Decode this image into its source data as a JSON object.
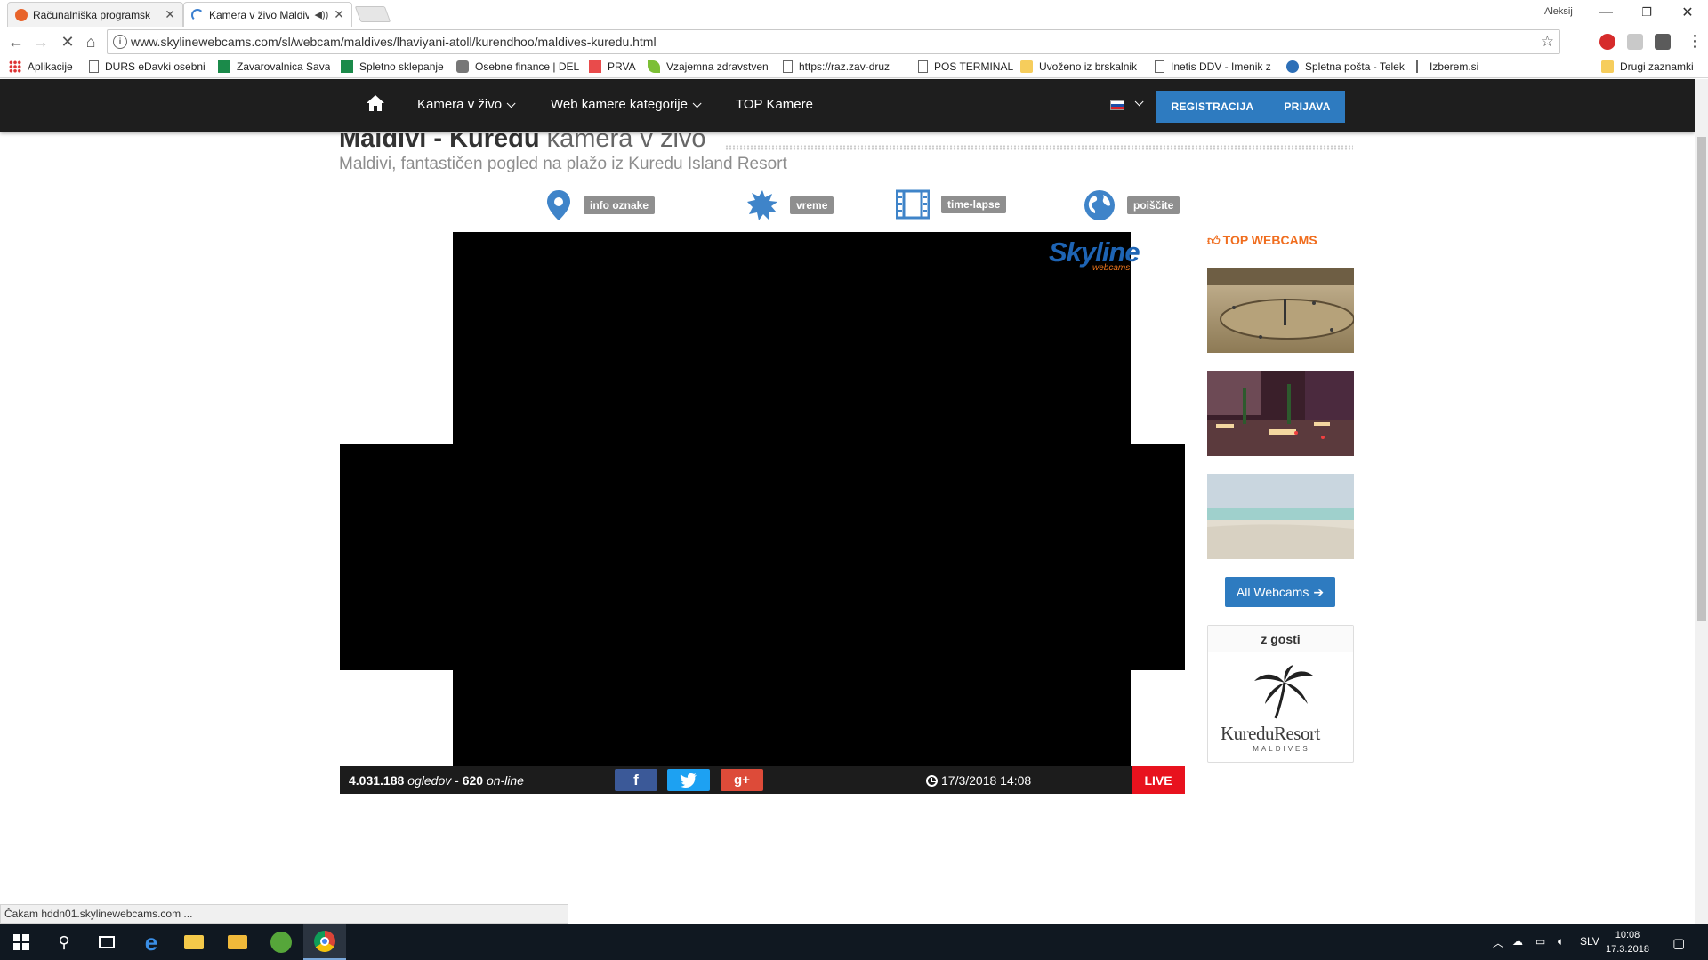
{
  "browser": {
    "tabs": [
      {
        "title": "Računalniška programsk",
        "active": false
      },
      {
        "title": "Kamera v živo Maldiv",
        "active": true
      }
    ],
    "profile_name": "Aleksij",
    "url": "www.skylinewebcams.com/sl/webcam/maldives/lhaviyani-atoll/kurendhoo/maldives-kuredu.html",
    "bookmarks": [
      {
        "label": "Aplikacije",
        "icon": "apps-grid-icon"
      },
      {
        "label": "DURS eDavki osebni",
        "icon": "page-icon"
      },
      {
        "label": "Zavarovalnica Sava",
        "icon": "sava-icon"
      },
      {
        "label": "Spletno sklepanje",
        "icon": "sava-icon"
      },
      {
        "label": "Osebne finance | DEL",
        "icon": "finance-icon"
      },
      {
        "label": "PRVA",
        "icon": "prva-icon"
      },
      {
        "label": "Vzajemna zdravstven",
        "icon": "leaf-icon"
      },
      {
        "label": "https://raz.zav-druz",
        "icon": "page-icon"
      },
      {
        "label": "POS TERMINAL",
        "icon": "page-icon"
      },
      {
        "label": "Uvoženo iz brskalnik",
        "icon": "folder-icon"
      },
      {
        "label": "Inetis DDV - Imenik z",
        "icon": "page-icon"
      },
      {
        "label": "Spletna pošta - Telek",
        "icon": "telekom-icon"
      },
      {
        "label": "Izberem.si",
        "icon": "izberem-icon"
      },
      {
        "label": "Drugi zaznamki",
        "icon": "folder-icon"
      }
    ],
    "status_text": "Čakam hddn01.skylinewebcams.com ..."
  },
  "site_nav": {
    "items": [
      "Kamera v živo",
      "Web kamere kategorije",
      "TOP Kamere"
    ],
    "register_label": "REGISTRACIJA",
    "login_label": "PRIJAVA"
  },
  "page": {
    "title_bold": "Maldivi - Kuredu",
    "title_rest": "kamera v živo",
    "subtitle": "Maldivi, fantastičen pogled na plažo iz Kuredu Island Resort",
    "info_links": [
      "info oznake",
      "vreme",
      "time-lapse",
      "poiščite"
    ]
  },
  "player": {
    "logo_main": "Skyline",
    "logo_sub": "webcams",
    "views": "4.031.188",
    "views_label": "ogledov",
    "online": "620",
    "online_label": "on-line",
    "datetime": "17/3/2018 14:08",
    "live_label": "LIVE"
  },
  "sidebar": {
    "title": "TOP WEBCAMS",
    "all_button": "All Webcams",
    "guest_heading": "z gosti",
    "partner_name": "KureduResort",
    "partner_sub": "MALDIVES"
  },
  "taskbar": {
    "language": "SLV",
    "time": "10:08",
    "date": "17.3.2018"
  },
  "colors": {
    "nav_bg": "#1e1e1e",
    "accent_blue": "#2e7bc0",
    "accent_orange": "#f06d1e",
    "live_red": "#e8121e"
  }
}
